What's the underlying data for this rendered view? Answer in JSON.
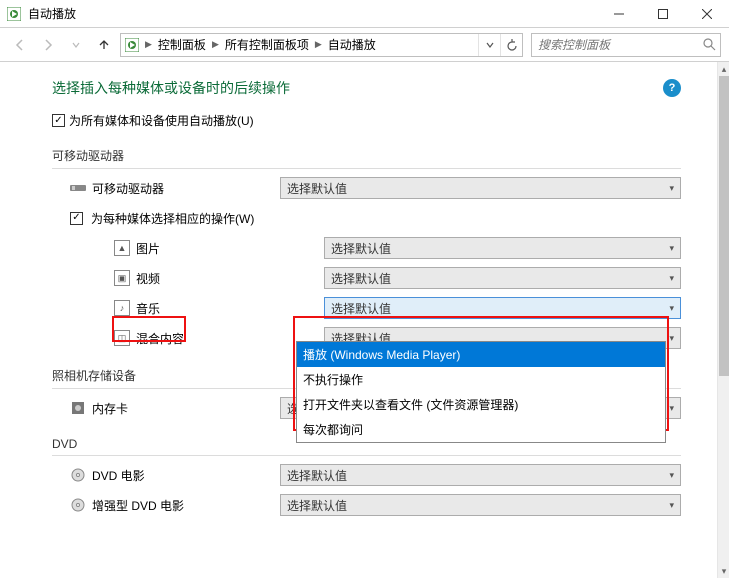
{
  "window": {
    "title": "自动播放"
  },
  "breadcrumb": {
    "items": [
      "控制面板",
      "所有控制面板项",
      "自动播放"
    ]
  },
  "search": {
    "placeholder": "搜索控制面板"
  },
  "page": {
    "heading": "选择插入每种媒体或设备时的后续操作",
    "global_checkbox": "为所有媒体和设备使用自动播放(U)"
  },
  "default_choice": "选择默认值",
  "sections": {
    "removable": {
      "title": "可移动驱动器",
      "drive_label": "可移动驱动器",
      "per_media_checkbox": "为每种媒体选择相应的操作(W)",
      "items": {
        "pictures": "图片",
        "videos": "视频",
        "music": "音乐",
        "mixed": "混合内容"
      }
    },
    "camera": {
      "title": "照相机存储设备",
      "item": "内存卡"
    },
    "dvd": {
      "title": "DVD",
      "items": {
        "movie": "DVD 电影",
        "enhanced": "增强型 DVD 电影"
      }
    }
  },
  "music_dropdown": {
    "options": [
      "播放 (Windows Media Player)",
      "不执行操作",
      "打开文件夹以查看文件 (文件资源管理器)",
      "每次都询问"
    ]
  }
}
